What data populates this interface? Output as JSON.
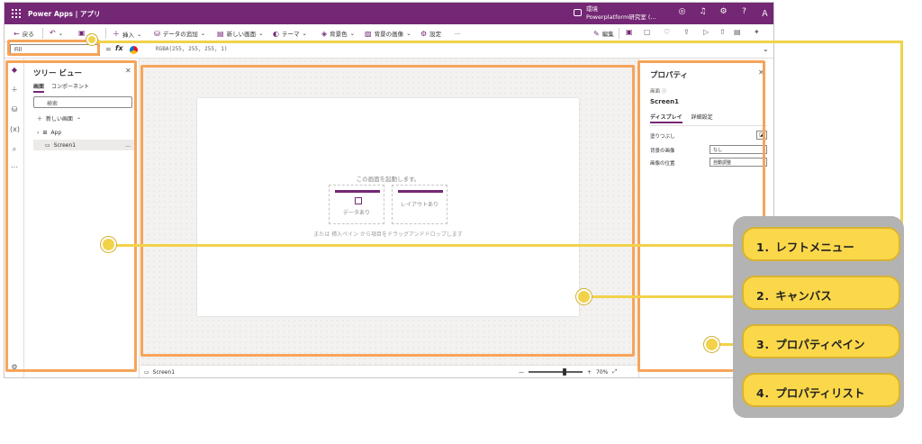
{
  "titlebar": {
    "app_title": "Power Apps | アプリ",
    "env_label": "環境",
    "env_name": "Powerplatform研究室 (..."
  },
  "commandbar": {
    "back": "戻る",
    "insert": "挿入",
    "add_data": "データの追加",
    "new_screen": "新しい画面",
    "theme": "テーマ",
    "bg_color": "背景色",
    "bg_image": "背景の画像",
    "settings": "設定",
    "more": "...",
    "edit": "編集"
  },
  "formulabar": {
    "property": "Fill",
    "eq": "=",
    "fx": "fx",
    "formula": "RGBA(255, 255, 255, 1)"
  },
  "treeview": {
    "title": "ツリー ビュー",
    "tab_screens": "画面",
    "tab_components": "コンポーネント",
    "search_placeholder": "検索",
    "new_screen": "新しい画面",
    "nodes": [
      {
        "label": "App"
      },
      {
        "label": "Screen1"
      }
    ],
    "node_more": "..."
  },
  "canvas": {
    "hint": "この画面を起動します。",
    "template_data": "データあり",
    "template_layout": "レイアウトあり",
    "hint2": "または 挿入ペイン から項目をドラッグアンドドロップします"
  },
  "statusbar": {
    "screen": "Screen1",
    "zoom_minus": "—",
    "zoom_plus": "+",
    "zoom_level": "70%",
    "zoom_fraction": 0.7
  },
  "properties": {
    "title": "プロパティ",
    "kind": "画面",
    "name": "Screen1",
    "tab_display": "ディスプレイ",
    "tab_advanced": "詳細設定",
    "rows": [
      {
        "label": "塗りつぶし",
        "value": ""
      },
      {
        "label": "背景の画像",
        "value": "なし"
      },
      {
        "label": "画像の位置",
        "value": "自動調整"
      }
    ]
  },
  "legend": {
    "items": [
      "1．レフトメニュー",
      "2．キャンバス",
      "3．プロパティペイン",
      "4．プロパティリスト"
    ]
  },
  "colors": {
    "brand": "#742774",
    "annotation_box": "#f7a45a",
    "annotation_line": "#f2d24a",
    "legend_panel": "#b3b3b3"
  }
}
